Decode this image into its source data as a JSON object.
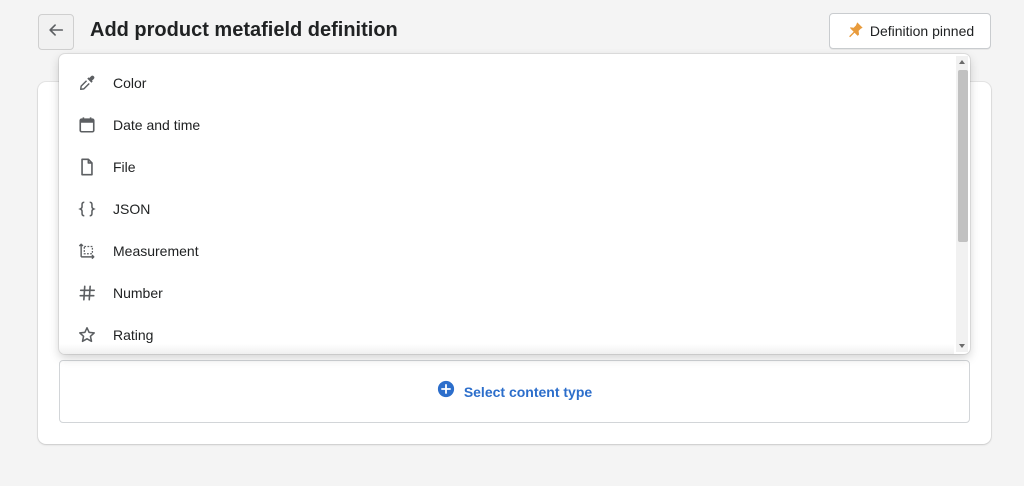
{
  "header": {
    "title": "Add product metafield definition",
    "pin_button_label": "Definition pinned"
  },
  "dropdown": {
    "options": [
      {
        "label": "Color",
        "icon": "eyedropper-icon"
      },
      {
        "label": "Date and time",
        "icon": "calendar-icon"
      },
      {
        "label": "File",
        "icon": "file-icon"
      },
      {
        "label": "JSON",
        "icon": "braces-icon"
      },
      {
        "label": "Measurement",
        "icon": "measurement-icon"
      },
      {
        "label": "Number",
        "icon": "hash-icon"
      },
      {
        "label": "Rating",
        "icon": "star-icon"
      }
    ]
  },
  "content_type": {
    "label": "Select content type",
    "icon": "plus-circle-icon"
  },
  "colors": {
    "accent": "#2c6ecb",
    "pin": "#e89b3c",
    "icon": "#5c5f62"
  }
}
